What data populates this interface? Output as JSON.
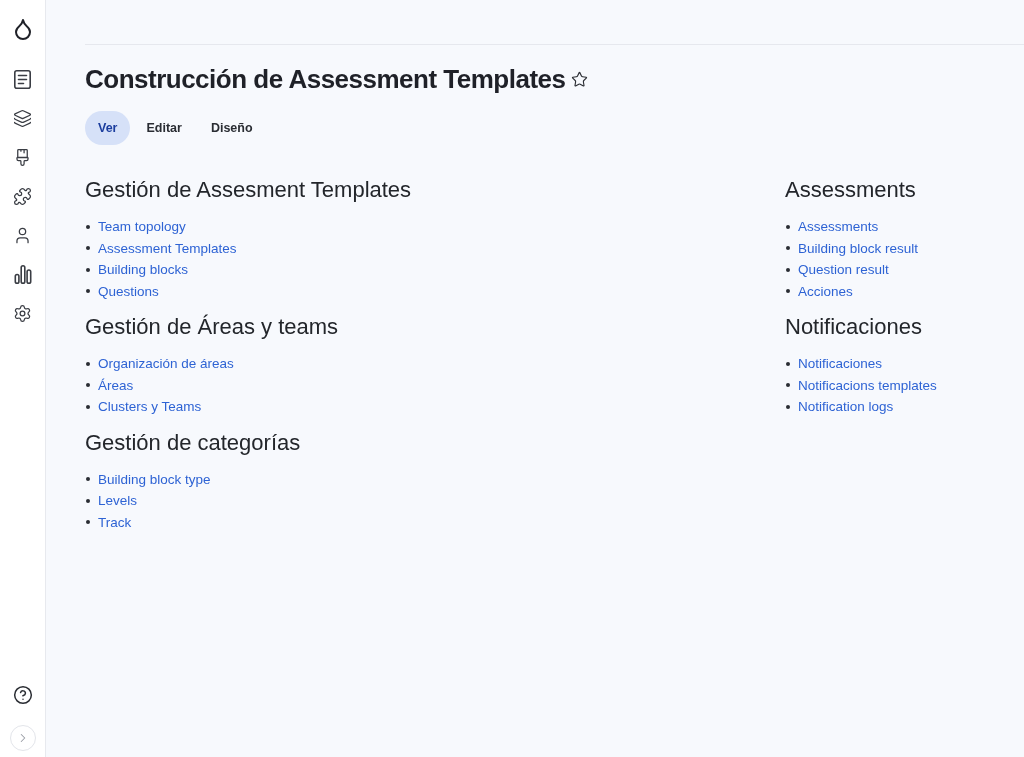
{
  "page": {
    "title": "Construcción de Assessment Templates",
    "favorite": false
  },
  "tabs": [
    {
      "label": "Ver",
      "selected": true
    },
    {
      "label": "Editar",
      "selected": false
    },
    {
      "label": "Diseño",
      "selected": false
    }
  ],
  "columns": [
    {
      "sections": [
        {
          "heading": "Gestión de Assesment Templates",
          "links": [
            "Team topology",
            "Assessment Templates",
            "Building blocks",
            "Questions"
          ]
        },
        {
          "heading": "Gestión de Áreas y teams",
          "links": [
            "Organización de áreas",
            "Áreas",
            "Clusters y Teams"
          ]
        },
        {
          "heading": "Gestión de categorías",
          "links": [
            "Building block type",
            "Levels",
            "Track"
          ]
        }
      ]
    },
    {
      "sections": [
        {
          "heading": "Assessments",
          "links": [
            "Assessments",
            "Building block result",
            "Question result",
            "Acciones"
          ]
        },
        {
          "heading": "Notificaciones",
          "links": [
            "Notificaciones",
            "Notificacions templates",
            "Notification logs"
          ]
        }
      ]
    }
  ]
}
